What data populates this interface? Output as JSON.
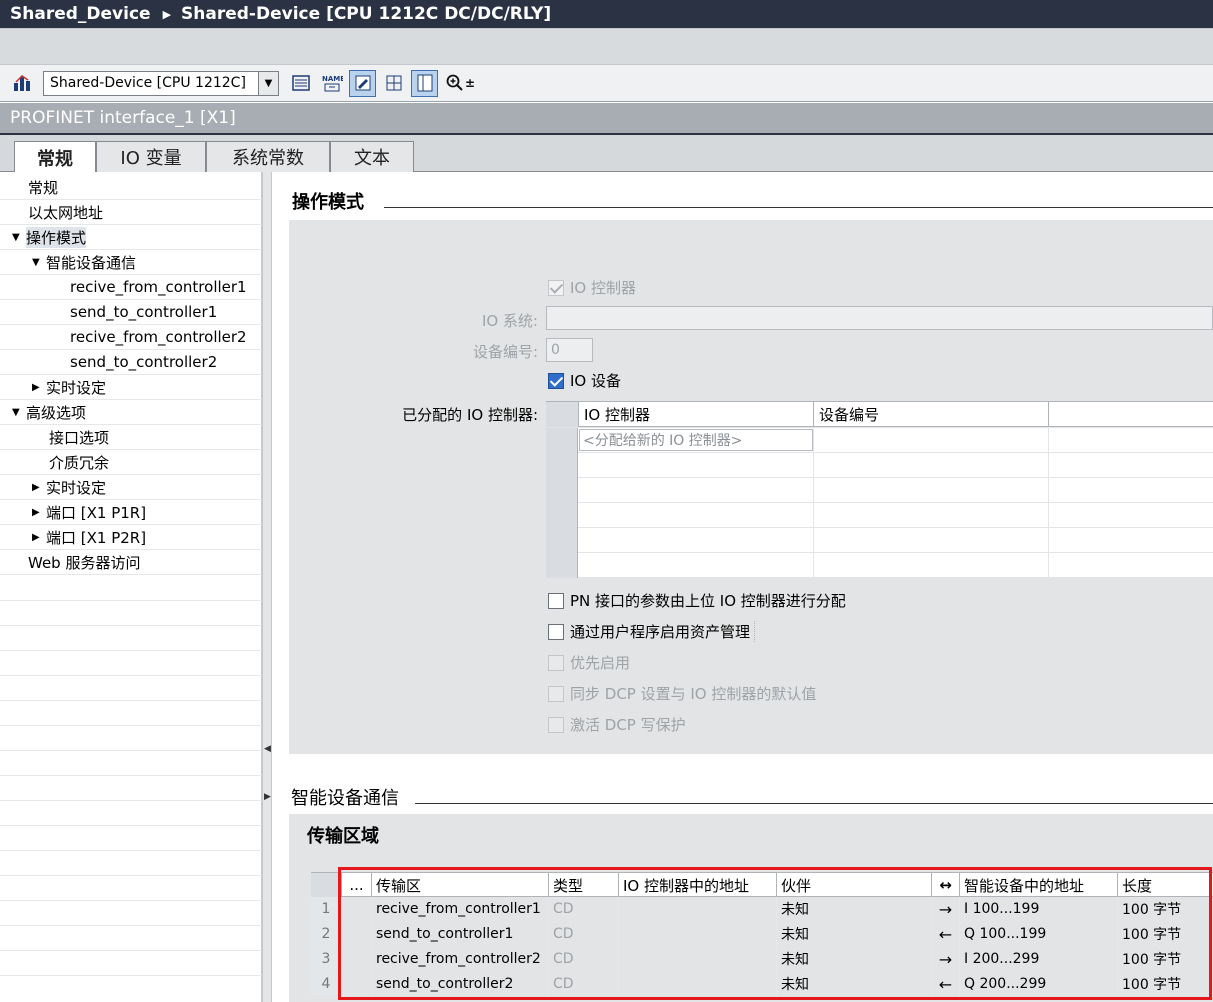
{
  "window": {
    "breadcrumb_root": "Shared_Device",
    "breadcrumb_sep": "▶",
    "breadcrumb_device": "Shared-Device [CPU 1212C DC/DC/RLY]"
  },
  "toolbar": {
    "device_select_value": "Shared-Device [CPU 1212C]",
    "zoom_label": "⊕±"
  },
  "interface_title": "PROFINET interface_1 [X1]",
  "tabs": [
    {
      "label": "常规"
    },
    {
      "label": "IO 变量"
    },
    {
      "label": "系统常数"
    },
    {
      "label": "文本"
    }
  ],
  "nav": {
    "items": [
      {
        "label": "常规"
      },
      {
        "label": "以太网地址"
      },
      {
        "label": "操作模式"
      },
      {
        "label": "智能设备通信"
      },
      {
        "label": "recive_from_controller1"
      },
      {
        "label": "send_to_controller1"
      },
      {
        "label": "recive_from_controller2"
      },
      {
        "label": "send_to_controller2"
      },
      {
        "label": "实时设定"
      },
      {
        "label": "高级选项"
      },
      {
        "label": "接口选项"
      },
      {
        "label": "介质冗余"
      },
      {
        "label": "实时设定"
      },
      {
        "label": "端口 [X1 P1R]"
      },
      {
        "label": "端口 [X1 P2R]"
      },
      {
        "label": "Web 服务器访问"
      }
    ]
  },
  "operating_mode": {
    "section_title": "操作模式",
    "io_controller_label": "IO 控制器",
    "io_system_label": "IO 系统:",
    "io_system_value": "",
    "device_number_label": "设备编号:",
    "device_number_value": "0",
    "io_device_label": "IO 设备",
    "assigned_controllers_label": "已分配的 IO 控制器:",
    "assigned_table": {
      "col_controller": "IO 控制器",
      "col_device_number": "设备编号",
      "new_controller_placeholder": "<分配给新的 IO 控制器>"
    },
    "options": [
      {
        "label": "PN 接口的参数由上位 IO 控制器进行分配"
      },
      {
        "label": "通过用户程序启用资产管理"
      },
      {
        "label": "优先启用"
      },
      {
        "label": "同步 DCP 设置与 IO 控制器的默认值"
      },
      {
        "label": "激活 DCP 写保护"
      }
    ]
  },
  "idevice_comm": {
    "section_title": "智能设备通信",
    "transfer_title": "传输区域",
    "table": {
      "headers": {
        "dots": "...",
        "area": "传输区",
        "type": "类型",
        "ctrl_addr": "IO 控制器中的地址",
        "partner": "伙伴",
        "dir": "↔",
        "dev_addr": "智能设备中的地址",
        "length": "长度"
      },
      "rows": [
        {
          "idx": "1",
          "area": "recive_from_controller1",
          "type": "CD",
          "ctrl_addr": "",
          "partner": "未知",
          "dir": "→",
          "dev_addr": "I 100...199",
          "length": "100 字节"
        },
        {
          "idx": "2",
          "area": "send_to_controller1",
          "type": "CD",
          "ctrl_addr": "",
          "partner": "未知",
          "dir": "←",
          "dev_addr": "Q 100...199",
          "length": "100 字节"
        },
        {
          "idx": "3",
          "area": "recive_from_controller2",
          "type": "CD",
          "ctrl_addr": "",
          "partner": "未知",
          "dir": "→",
          "dev_addr": "I 200...299",
          "length": "100 字节"
        },
        {
          "idx": "4",
          "area": "send_to_controller2",
          "type": "CD",
          "ctrl_addr": "",
          "partner": "未知",
          "dir": "←",
          "dev_addr": "Q 200...299",
          "length": "100 字节"
        }
      ]
    }
  }
}
